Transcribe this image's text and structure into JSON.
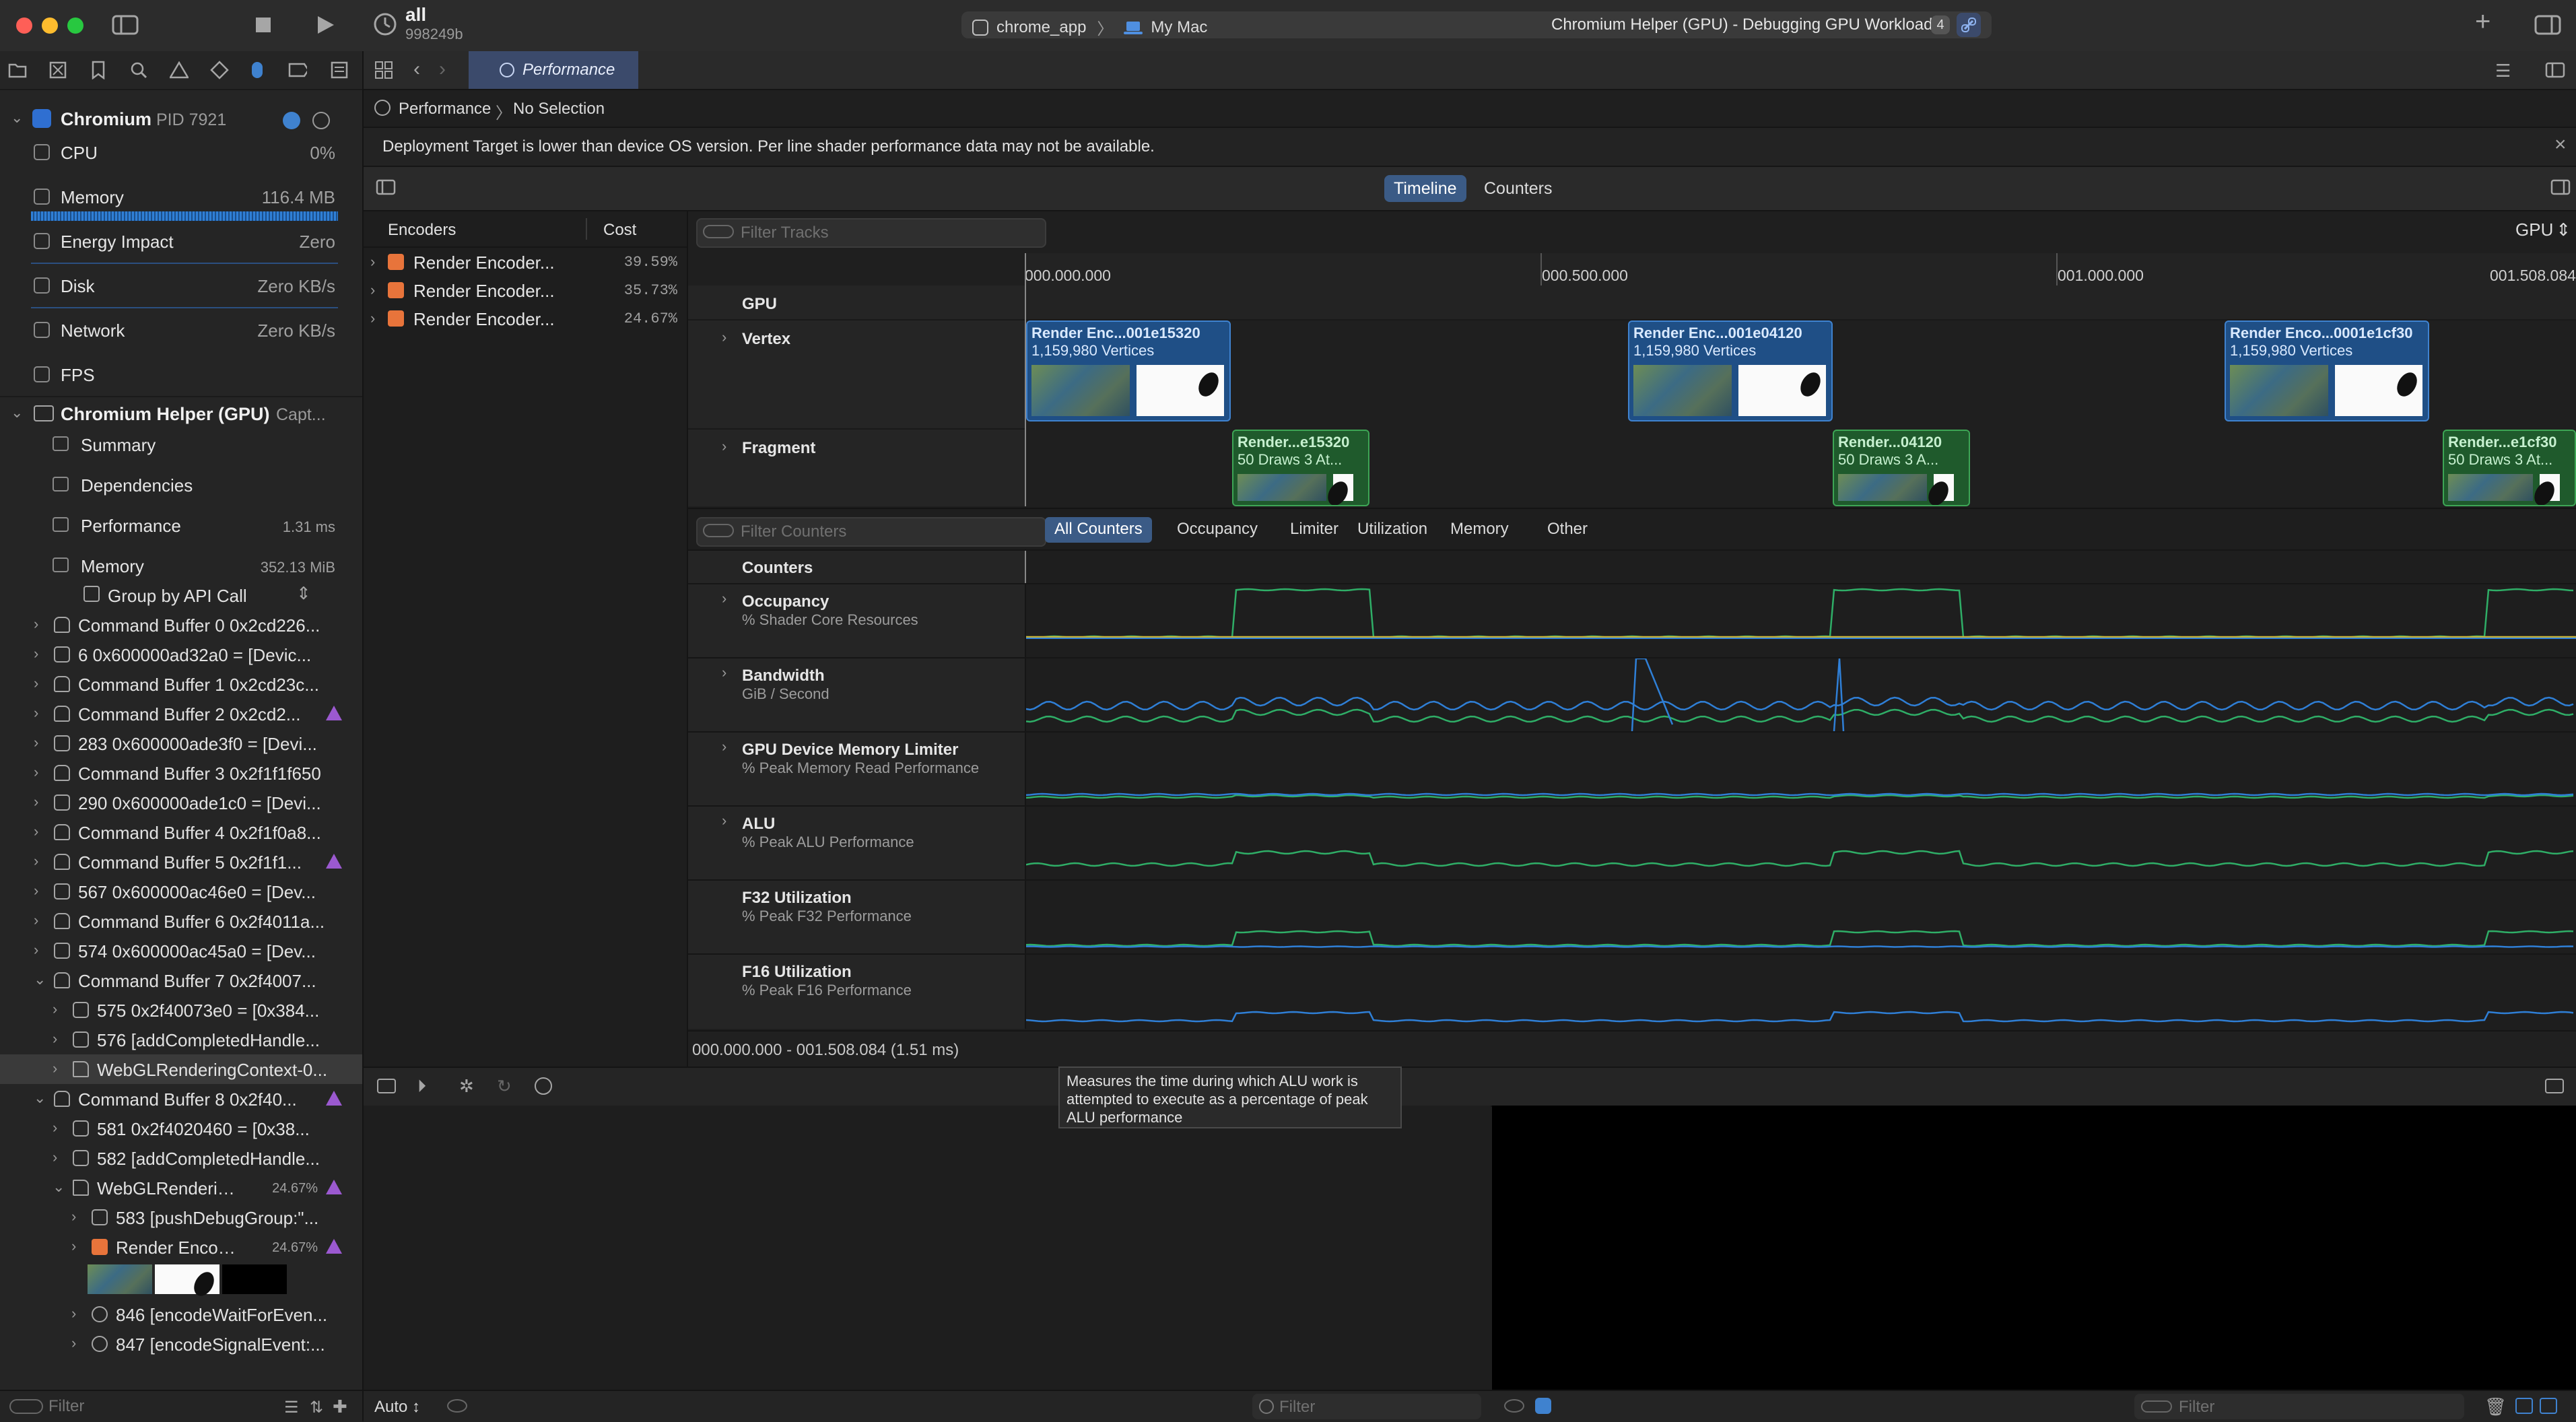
{
  "toolbar": {
    "target_name": "all",
    "target_id": "998249b",
    "scheme_app": "chrome_app",
    "scheme_destination": "My Mac",
    "window_title": "Chromium Helper (GPU) - Debugging GPU Workload",
    "title_badge": "4",
    "add_label": "+"
  },
  "debug_navigator": {
    "process_name": "Chromium",
    "process_pid": "PID 7921",
    "gauges": [
      {
        "label": "CPU",
        "value": "0%",
        "icon": "cpu-icon"
      },
      {
        "label": "Memory",
        "value": "116.4 MB",
        "icon": "memory-icon"
      },
      {
        "label": "Energy Impact",
        "value": "Zero",
        "icon": "energy-icon"
      },
      {
        "label": "Disk",
        "value": "Zero KB/s",
        "icon": "disk-icon"
      },
      {
        "label": "Network",
        "value": "Zero KB/s",
        "icon": "network-icon"
      },
      {
        "label": "FPS",
        "value": "",
        "icon": "fps-icon"
      }
    ],
    "gpu_process": "Chromium Helper (GPU)",
    "gpu_process_suffix": "Capt...",
    "gpu_items": [
      {
        "label": "Summary",
        "value": ""
      },
      {
        "label": "Dependencies",
        "value": ""
      },
      {
        "label": "Performance",
        "value": "1.31 ms"
      },
      {
        "label": "Memory",
        "value": "352.13 MiB"
      }
    ],
    "group_by": "Group by API Call",
    "tree": [
      {
        "label": "Command Buffer 0 0x2cd226...",
        "indent": 0,
        "kind": "cmd",
        "open": false,
        "warn": false,
        "pct": ""
      },
      {
        "label": "6 0x600000ad32a0 = [Devic...",
        "indent": 0,
        "kind": "fn",
        "open": false,
        "warn": false,
        "pct": ""
      },
      {
        "label": "Command Buffer 1 0x2cd23c...",
        "indent": 0,
        "kind": "cmd",
        "open": false,
        "warn": false,
        "pct": ""
      },
      {
        "label": "Command Buffer 2 0x2cd2...",
        "indent": 0,
        "kind": "cmd",
        "open": false,
        "warn": true,
        "pct": ""
      },
      {
        "label": "283 0x600000ade3f0 = [Devi...",
        "indent": 0,
        "kind": "fn",
        "open": false,
        "warn": false,
        "pct": ""
      },
      {
        "label": "Command Buffer 3 0x2f1f1f650",
        "indent": 0,
        "kind": "cmd",
        "open": false,
        "warn": false,
        "pct": ""
      },
      {
        "label": "290 0x600000ade1c0 = [Devi...",
        "indent": 0,
        "kind": "fn",
        "open": false,
        "warn": false,
        "pct": ""
      },
      {
        "label": "Command Buffer 4 0x2f1f0a8...",
        "indent": 0,
        "kind": "cmd",
        "open": false,
        "warn": false,
        "pct": ""
      },
      {
        "label": "Command Buffer 5 0x2f1f1...",
        "indent": 0,
        "kind": "cmd",
        "open": false,
        "warn": true,
        "pct": ""
      },
      {
        "label": "567 0x600000ac46e0 = [Dev...",
        "indent": 0,
        "kind": "fn",
        "open": false,
        "warn": false,
        "pct": ""
      },
      {
        "label": "Command Buffer 6 0x2f4011a...",
        "indent": 0,
        "kind": "cmd",
        "open": false,
        "warn": false,
        "pct": ""
      },
      {
        "label": "574 0x600000ac45a0 = [Dev...",
        "indent": 0,
        "kind": "fn",
        "open": false,
        "warn": false,
        "pct": ""
      },
      {
        "label": "Command Buffer 7 0x2f4007...",
        "indent": 0,
        "kind": "cmd",
        "open": true,
        "warn": false,
        "pct": ""
      },
      {
        "label": "575 0x2f40073e0 = [0x384...",
        "indent": 1,
        "kind": "fn",
        "open": false,
        "warn": false,
        "pct": ""
      },
      {
        "label": "576 [addCompletedHandle...",
        "indent": 1,
        "kind": "fn",
        "open": false,
        "warn": false,
        "pct": ""
      },
      {
        "label": "WebGLRenderingContext-0...",
        "indent": 1,
        "kind": "folder",
        "open": false,
        "warn": false,
        "pct": "",
        "selected": true
      },
      {
        "label": "Command Buffer 8 0x2f40...",
        "indent": 0,
        "kind": "cmd",
        "open": true,
        "warn": true,
        "pct": ""
      },
      {
        "label": "581 0x2f4020460 = [0x38...",
        "indent": 1,
        "kind": "fn",
        "open": false,
        "warn": false,
        "pct": ""
      },
      {
        "label": "582 [addCompletedHandle...",
        "indent": 1,
        "kind": "fn",
        "open": false,
        "warn": false,
        "pct": ""
      },
      {
        "label": "WebGLRendering...",
        "indent": 1,
        "kind": "folder",
        "open": true,
        "warn": true,
        "pct": "24.67%"
      },
      {
        "label": "583 [pushDebugGroup:\"...",
        "indent": 2,
        "kind": "fn",
        "open": false,
        "warn": false,
        "pct": ""
      },
      {
        "label": "Render Encode...",
        "indent": 2,
        "kind": "enc",
        "open": false,
        "warn": true,
        "pct": "24.67%"
      },
      {
        "label": "846 [encodeWaitForEven...",
        "indent": 2,
        "kind": "event",
        "open": false,
        "warn": false,
        "pct": ""
      },
      {
        "label": "847 [encodeSignalEvent:...",
        "indent": 2,
        "kind": "event",
        "open": false,
        "warn": false,
        "pct": ""
      }
    ],
    "filter_placeholder": "Filter"
  },
  "editor": {
    "tab_label": "Performance",
    "breadcrumb_root": "Performance",
    "breadcrumb_leaf": "No Selection",
    "info_message": "Deployment Target is lower than device OS version. Per line shader performance data may not be available.",
    "modes": [
      "Timeline",
      "Counters"
    ],
    "active_mode": "Timeline"
  },
  "encoders": {
    "col_name": "Encoders",
    "col_cost": "Cost",
    "rows": [
      {
        "label": "Render Encoder...",
        "cost": "39.59%"
      },
      {
        "label": "Render Encoder...",
        "cost": "35.73%"
      },
      {
        "label": "Render Encoder...",
        "cost": "24.67%"
      }
    ]
  },
  "timeline": {
    "filter_placeholder": "Filter Tracks",
    "device": "GPU",
    "ruler": [
      "000.000.000",
      "000.500.000",
      "001.000.000",
      "001.508.084"
    ],
    "tracks": [
      "GPU",
      "Vertex",
      "Fragment"
    ],
    "vertex_blocks": [
      {
        "title": "Render Enc...001e15320",
        "detail": "1,159,980 Vertices"
      },
      {
        "title": "Render Enc...001e04120",
        "detail": "1,159,980 Vertices"
      },
      {
        "title": "Render Enco...0001e1cf30",
        "detail": "1,159,980 Vertices"
      }
    ],
    "fragment_blocks": [
      {
        "title": "Render...e15320",
        "detail": "50 Draws    3 At..."
      },
      {
        "title": "Render...04120",
        "detail": "50 Draws    3 A..."
      },
      {
        "title": "Render...e1cf30",
        "detail": "50 Draws    3 At..."
      }
    ]
  },
  "counters": {
    "filter_placeholder": "Filter Counters",
    "scopes": [
      "All Counters",
      "Occupancy",
      "Limiter",
      "Utilization",
      "Memory",
      "Other"
    ],
    "active_scope": "All Counters",
    "header": "Counters",
    "rows": [
      {
        "name": "Occupancy",
        "unit": "% Shader Core Resources",
        "expandable": true
      },
      {
        "name": "Bandwidth",
        "unit": "GiB / Second",
        "expandable": true
      },
      {
        "name": "GPU Device Memory Limiter",
        "unit": "% Peak Memory Read Performance",
        "expandable": true
      },
      {
        "name": "ALU",
        "unit": "% Peak ALU Performance",
        "expandable": true
      },
      {
        "name": "F32 Utilization",
        "unit": "% Peak F32 Performance",
        "expandable": false
      },
      {
        "name": "F16 Utilization",
        "unit": "% Peak F16 Performance",
        "expandable": false
      }
    ],
    "range": "000.000.000 - 001.508.084 (1.51 ms)",
    "tooltip": "Measures the time during which ALU work is attempted to execute as a percentage of peak ALU performance"
  },
  "bottom": {
    "variables_mode": "Auto ↕",
    "variables_filter": "Filter",
    "console_filter": "Filter"
  },
  "colors": {
    "accent": "#3f82cf",
    "green_series": "#2fae67",
    "blue_series": "#2f7fd6",
    "yellow_series": "#c9b53a",
    "warning": "#9b59d0"
  }
}
